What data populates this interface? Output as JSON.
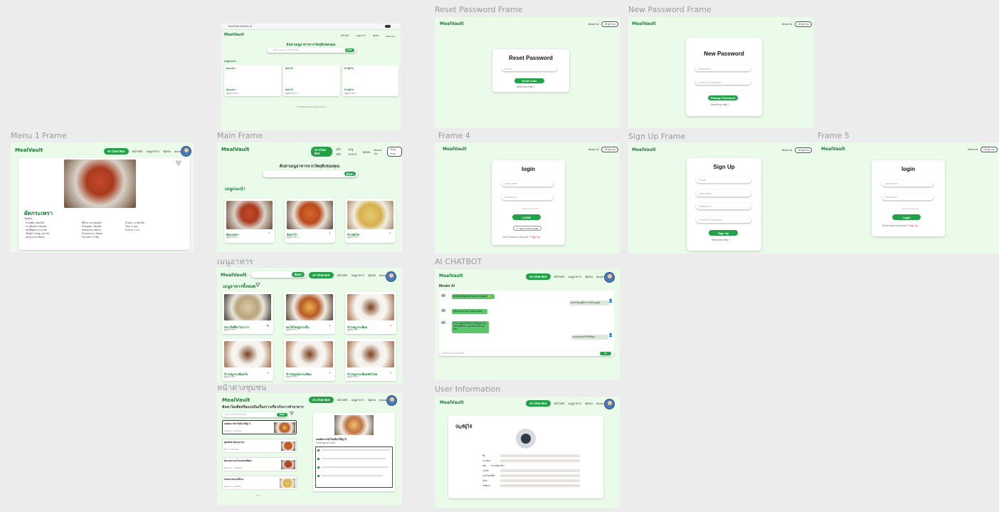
{
  "brand": "MealVault",
  "frame_labels": {
    "reset": "Reset Password  Frame",
    "newpass": "New Password Frame",
    "menu1": "Menu 1 Frame",
    "main": "Main Frame",
    "frame4": "Frame 4",
    "signup": "Sign Up Frame",
    "frame5": "Frame 5",
    "menu": "เมนูอาหาร",
    "chatbot": "AI CHATBOT",
    "community": "หน้าต่างชุมชน",
    "userinfo": "User Information"
  },
  "nav": {
    "chat": "AI Chat Bot",
    "items": [
      "หน้าหลัก",
      "เมนูอาหาร",
      "ชุมชน",
      "About Us"
    ],
    "about": "About Us",
    "login": "เข้าสู่ระบบ"
  },
  "browser": {
    "url": "MealVault Website UI",
    "title": "ค้นหาเมนูอาหารจากวัตถุดิบของคุณ",
    "search_placeholder": "ค้นหาเมนูอาหารด้วยวัตถุดิบ",
    "search_btn": "ค้นหา",
    "section": "เมนูแนะนำ",
    "cards": [
      {
        "title": "ผัดกะเพรา",
        "sub": "ดูสูตรอาหาร →"
      },
      {
        "title": "ต้มข่าไก่",
        "sub": "ดูสูตรอาหาร →"
      },
      {
        "title": "ข้าวผัดไข่",
        "sub": "ดูสูตรอาหาร →"
      }
    ],
    "footer": "© 2024 MealVault. All rights reserved."
  },
  "menu1": {
    "dish": "ผัดกระเพรา",
    "ingredients_title": "วัตถุดิบ",
    "col1": [
      "น้ำมันพืช 1 ช้อนโต๊ะ",
      "กระเทียมสับ 1 ช้อนโต๊ะ",
      "พริกขี้หนูสวน 5-10 เม็ด",
      "เนื้อสัตว์ (ไก่/หมู) 150 กรัม",
      "ผงปรุงรส 1/2 ช้อนชา"
    ],
    "col2": [
      "ซีอิ๊วขาว 1/2 ช้อนโต๊ะ",
      "น้ำมันหอย 1 ช้อนโต๊ะ",
      "ซอสปรุงรส 1 ช้อนชา",
      "น้ำตาลทราย 1 ช้อนชา",
      "ใบกะเพรา 1 กำมือ"
    ],
    "col3": [
      "น้ำเปล่า 2-3 ช้อนโต๊ะ",
      "ไข่ดาว 1 ฟอง",
      "ข้าวสวย 1 จาน"
    ]
  },
  "main": {
    "title": "ค้นหาเมนูอาหารจากวัตถุดิบของคุณ",
    "search_btn": "ค้นหา",
    "section": "เมนูแนะนำ",
    "cards": [
      {
        "title": "ผัดกะเพรา",
        "sub": "ดูสูตรอาหาร →"
      },
      {
        "title": "ต้มข่าไก่",
        "sub": "ดูสูตรอาหาร →"
      },
      {
        "title": "ข้าวผัดไข่",
        "sub": "ดูสูตรอาหาร →"
      }
    ]
  },
  "menu_page": {
    "section": "เมนูอาหารทั้งหมด",
    "search_btn": "ค้นหา",
    "cards": [
      {
        "title": "สปาเก็ตตี้คาโบนาร่า",
        "sub": "ดูสูตรอาหาร"
      },
      {
        "title": "พะโล้ไข่หมูสามชั้น",
        "sub": "ดูสูตรอาหาร"
      },
      {
        "title": "ข้าวหมูกระเทียม",
        "sub": "ดูสูตรอาหาร"
      },
      {
        "title": "ข้าวหมูกระเทียมไข่",
        "sub": "ดูสูตรอาหาร"
      },
      {
        "title": "ข้าวหมูทอดกระเทียม",
        "sub": "ดูสูตรอาหาร"
      },
      {
        "title": "ข้าวหมูกระเทียมพริกไทย",
        "sub": "ดูสูตรอาหาร"
      }
    ]
  },
  "reset": {
    "title": "Reset  Password",
    "email": "Email",
    "btn": "Send Code",
    "help": "Need Any Help ?"
  },
  "newpass": {
    "title": "New Password",
    "f1": "Password",
    "f2": "Confirm Password",
    "btn": "Change Password",
    "help": "Need Any Help ?"
  },
  "login": {
    "title": "login",
    "user": "Username",
    "pass": "Password",
    "forgot": "Forgot Password?",
    "btn": "LOGIN",
    "google": "Sign in with Google",
    "noacc": "Don't Have an Account ?",
    "signup": "Sign Up"
  },
  "signup": {
    "title": "Sign Up",
    "f1": "Email",
    "f2": "Username",
    "f3": "Password",
    "f4": "Confirm Password",
    "btn": "Sign Up",
    "help": "Need Any Help ?"
  },
  "login5": {
    "title": "login",
    "user": "Username",
    "pass": "Password",
    "forgot": "Forgot Password?",
    "btn": "Login",
    "noacc": "Don't Have a Account ?",
    "signup": "Sign Up"
  },
  "chat": {
    "title": "Mealer AI",
    "m1": "สวัสดี ฉันคือผู้ช่วยด้านอาหารของคุณ 🙂",
    "u1": "อยากได้เมนูที่ทำจากไข่กับหมูสับ",
    "m2": "ได้เลย ขอแนะนำ ไข่เจียวหมูสับ",
    "m3": "เริ่มจากตอกไข่ใส่ชาม ใส่หมูสับ ปรุงรสด้วยซีอิ๊วขาว แล้วเจียวในน้ำมันร้อน",
    "u2": "ขอบคุณ ต้องใช้ไข่กี่ฟอง",
    "placeholder": "พิมพ์ข้อความของคุณที่นี่...",
    "send": "ส่ง"
  },
  "community": {
    "title": "ค้นหาไอเดียหรือแบ่งปันเรื่องราวเกี่ยวกับการทำอาหาร",
    "search_placeholder": "ค้นหาไอเดียหรือวัตถุดิบ",
    "search_btn": "ค้นหา",
    "posts": [
      {
        "title": "เทคนิคการทำไข่เจียวให้ฟู 🍳",
        "meta": "ไข่เจียวฟู · 2 ชม.ที่แล้ว"
      },
      {
        "title": "สูตรต้มยำกุ้งแบบง่ายๆ",
        "meta": "ต้มยำ · 5 ชม.ที่แล้ว"
      },
      {
        "title": "ผัดกะเพราแบบไหนอร่อยที่สุด?",
        "meta": "ผัดกะเพรา · 1 วันที่แล้ว"
      },
      {
        "title": "ขนมครกทำเองที่บ้าน",
        "meta": "ของหวาน · 2 วันที่แล้ว"
      }
    ],
    "detail_title": "เทคนิคการทำไข่เจียวให้ฟู 🍳",
    "detail_sub": "ไข่เจียวฟูกรอบ นุ่มใน",
    "more": "..."
  },
  "user": {
    "title": "บัญชีผู้ใช้",
    "fields": [
      "ชื่อ",
      "นามสกุล",
      "เพศ",
      "วันเกิด",
      "เบอร์โทรศัพท์",
      "อีเมล",
      "รหัสผ่าน"
    ],
    "gender": "ชาย หญิง อื่นๆ"
  }
}
